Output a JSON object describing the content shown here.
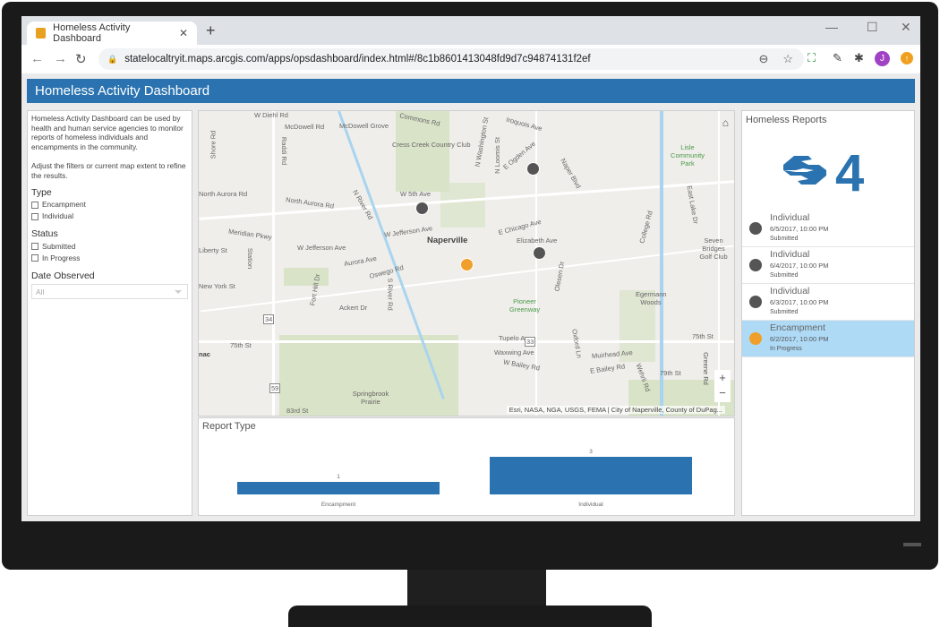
{
  "browser": {
    "tab_title": "Homeless Activity Dashboard",
    "url": "statelocaltryit.maps.arcgis.com/apps/opsdashboard/index.html#/8c1b8601413048fd9d7c94874131f2ef",
    "avatar_letter": "J"
  },
  "dashboard": {
    "title": "Homeless Activity Dashboard"
  },
  "sidebar": {
    "description": "Homeless Activity Dashboard can be used by health and human service agencies to monitor reports of homeless individuals and encampments in the community.",
    "hint": "Adjust the filters or current map extent to refine the results.",
    "type_label": "Type",
    "type_options": [
      "Encampment",
      "Individual"
    ],
    "status_label": "Status",
    "status_options": [
      "Submitted",
      "In Progress"
    ],
    "date_label": "Date Observed",
    "date_value": "All"
  },
  "map": {
    "labels": [
      "W Diehl Rd",
      "McDowell Rd",
      "McDowell Grove",
      "Cress Creek Country Club",
      "Commons Rd",
      "Shore Rd",
      "Raddi Rd",
      "North Aurora Rd",
      "North Aurora Rd",
      "N River Rd",
      "W 5th Ave",
      "Meridian Pkwy",
      "W Jefferson Ave",
      "W Jefferson Ave",
      "Naperville",
      "Aurora Ave",
      "Oswego Rd",
      "New York St",
      "Fort Hill Dr",
      "S River Rd",
      "Ackert Dr",
      "75th St",
      "Springbrook Prairie",
      "83rd St",
      "Iroquois Ave",
      "N Washington St",
      "N Loomis St",
      "E Ogden Ave",
      "Naper Blvd",
      "Lisle Community Park",
      "East Lake Dr",
      "E Chicago Ave",
      "Elizabeth Ave",
      "College Rd",
      "Seven Bridges Golf Club",
      "Pioneer Greenway",
      "Olesen Dr",
      "Egermann Woods",
      "Tupelo Ave",
      "Waxwing Ave",
      "W Bailey Rd",
      "Oxford Ln",
      "Muirhead Ave",
      "E Bailey Rd",
      "Wehrli Rd",
      "75th St",
      "79th St",
      "Greene Rd",
      "Liberty St",
      "Station",
      "34",
      "59",
      "33",
      "nac"
    ],
    "attribution": "Esri, NASA, NGA, USGS, FEMA | City of Naperville, County of DuPag...",
    "zoom_in": "+",
    "zoom_out": "−",
    "points": [
      {
        "type": "Individual",
        "color": "#555555"
      },
      {
        "type": "Individual",
        "color": "#555555"
      },
      {
        "type": "Individual",
        "color": "#555555"
      },
      {
        "type": "Encampment",
        "color": "#f0a02a"
      }
    ]
  },
  "chart_data": {
    "type": "bar",
    "title": "Report Type",
    "categories": [
      "Encampment",
      "Individual"
    ],
    "values": [
      1,
      3
    ],
    "value_labels": [
      "1",
      "3"
    ],
    "color": "#2a73b0",
    "ylim": [
      0,
      3
    ]
  },
  "reports": {
    "title": "Homeless Reports",
    "count": "4",
    "items": [
      {
        "type": "Individual",
        "date": "6/5/2017, 10:00 PM",
        "status": "Submitted",
        "color": "#555555",
        "selected": false
      },
      {
        "type": "Individual",
        "date": "6/4/2017, 10:00 PM",
        "status": "Submitted",
        "color": "#555555",
        "selected": false
      },
      {
        "type": "Individual",
        "date": "6/3/2017, 10:00 PM",
        "status": "Submitted",
        "color": "#555555",
        "selected": false
      },
      {
        "type": "Encampment",
        "date": "6/2/2017, 10:00 PM",
        "status": "In Progress",
        "color": "#f0a02a",
        "selected": true
      }
    ]
  },
  "colors": {
    "accent": "#2a73b0",
    "selected": "#afdaf6",
    "encampment": "#f0a02a",
    "individual": "#555555"
  }
}
